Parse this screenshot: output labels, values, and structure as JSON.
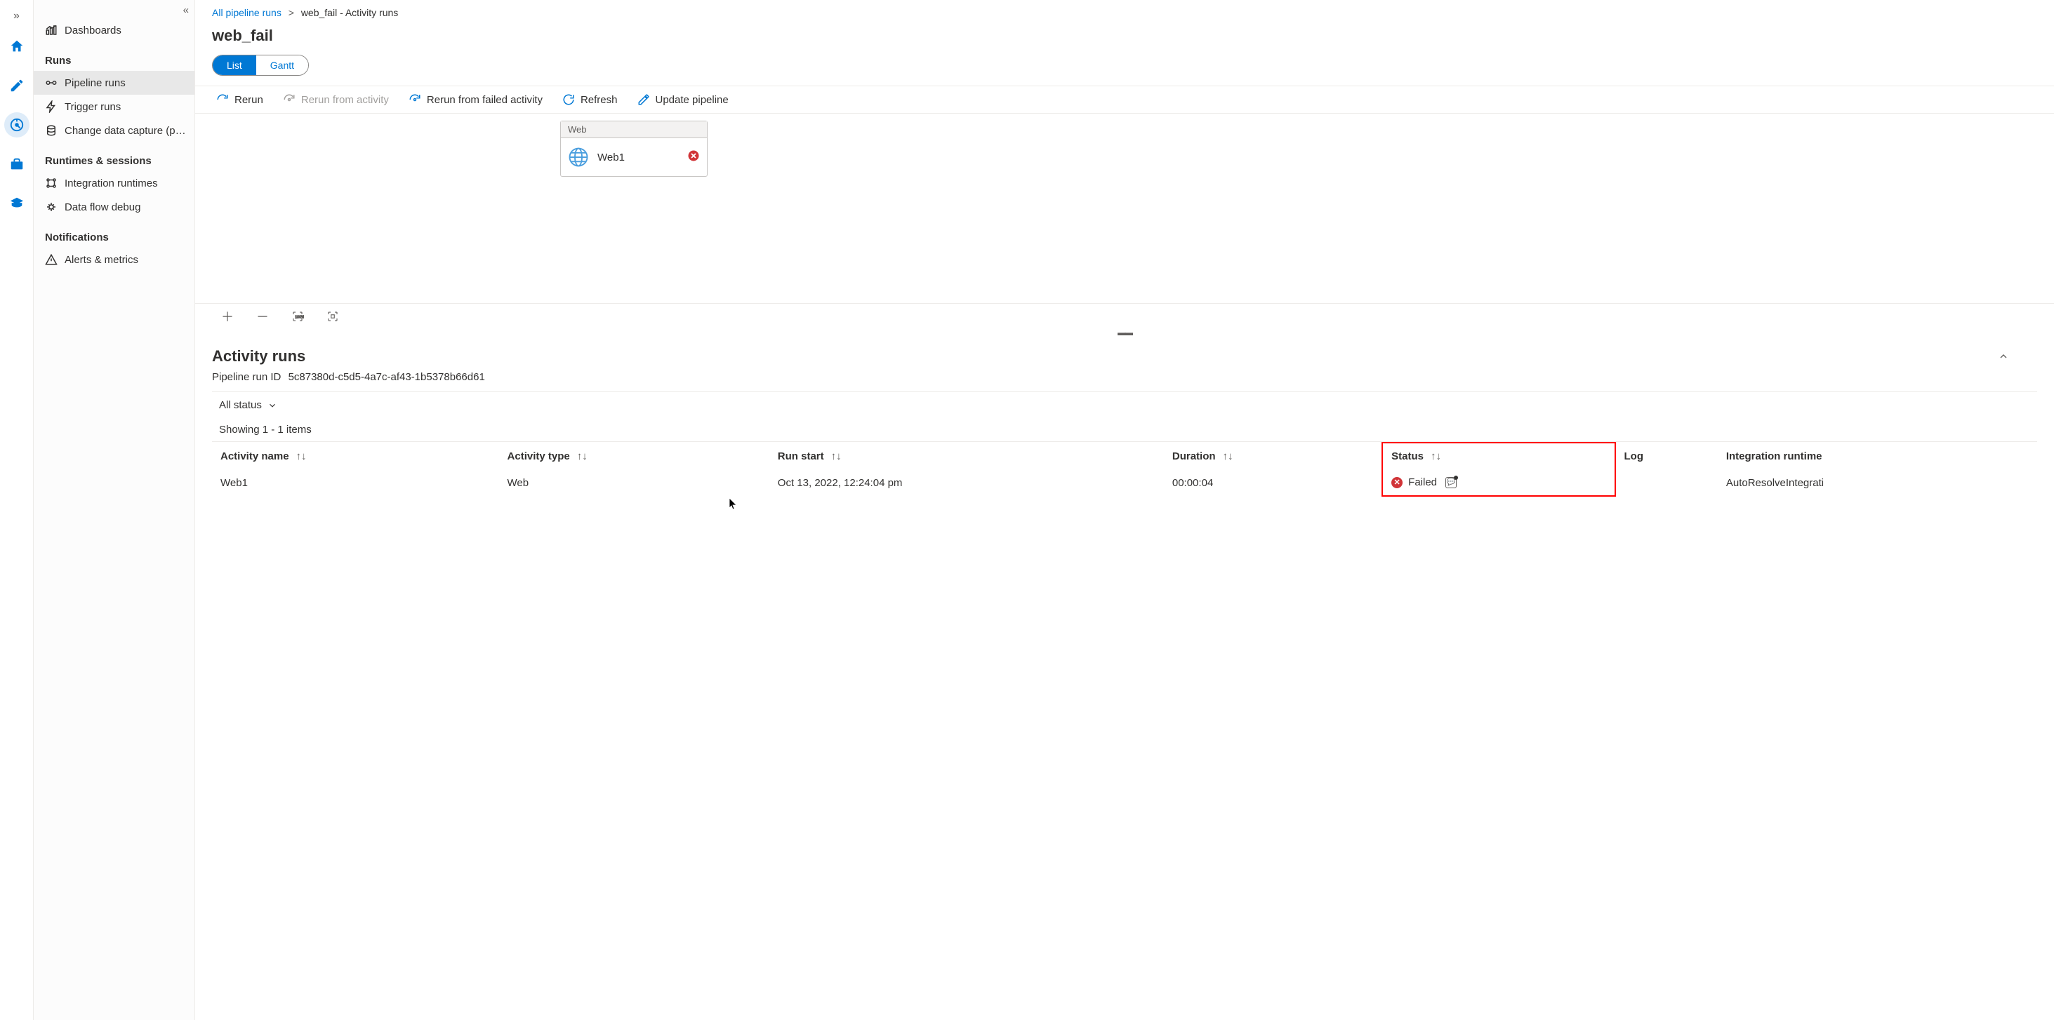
{
  "iconRail": {
    "items": [
      "home",
      "edit",
      "monitor",
      "toolbox",
      "learn"
    ]
  },
  "sidebar": {
    "dashboards": "Dashboards",
    "sections": {
      "runs": {
        "header": "Runs",
        "items": [
          {
            "label": "Pipeline runs",
            "selected": true
          },
          {
            "label": "Trigger runs",
            "selected": false
          },
          {
            "label": "Change data capture (previ...",
            "selected": false
          }
        ]
      },
      "runtimes": {
        "header": "Runtimes & sessions",
        "items": [
          {
            "label": "Integration runtimes"
          },
          {
            "label": "Data flow debug"
          }
        ]
      },
      "notifications": {
        "header": "Notifications",
        "items": [
          {
            "label": "Alerts & metrics"
          }
        ]
      }
    }
  },
  "breadcrumb": {
    "root": "All pipeline runs",
    "current": "web_fail - Activity runs"
  },
  "pageTitle": "web_fail",
  "viewToggle": {
    "list": "List",
    "gantt": "Gantt"
  },
  "toolbar": {
    "rerun": "Rerun",
    "rerunFromActivity": "Rerun from activity",
    "rerunFromFailed": "Rerun from failed activity",
    "refresh": "Refresh",
    "updatePipeline": "Update pipeline"
  },
  "node": {
    "type": "Web",
    "name": "Web1"
  },
  "activitySection": {
    "title": "Activity runs",
    "runIdLabel": "Pipeline run ID",
    "runIdValue": "5c87380d-c5d5-4a7c-af43-1b5378b66d61",
    "filterLabel": "All status",
    "countText": "Showing 1 - 1 items",
    "columns": {
      "activityName": "Activity name",
      "activityType": "Activity type",
      "runStart": "Run start",
      "duration": "Duration",
      "status": "Status",
      "log": "Log",
      "integrationRuntime": "Integration runtime"
    },
    "rows": [
      {
        "activityName": "Web1",
        "activityType": "Web",
        "runStart": "Oct 13, 2022, 12:24:04 pm",
        "duration": "00:00:04",
        "status": "Failed",
        "log": "",
        "integrationRuntime": "AutoResolveIntegrati"
      }
    ]
  }
}
